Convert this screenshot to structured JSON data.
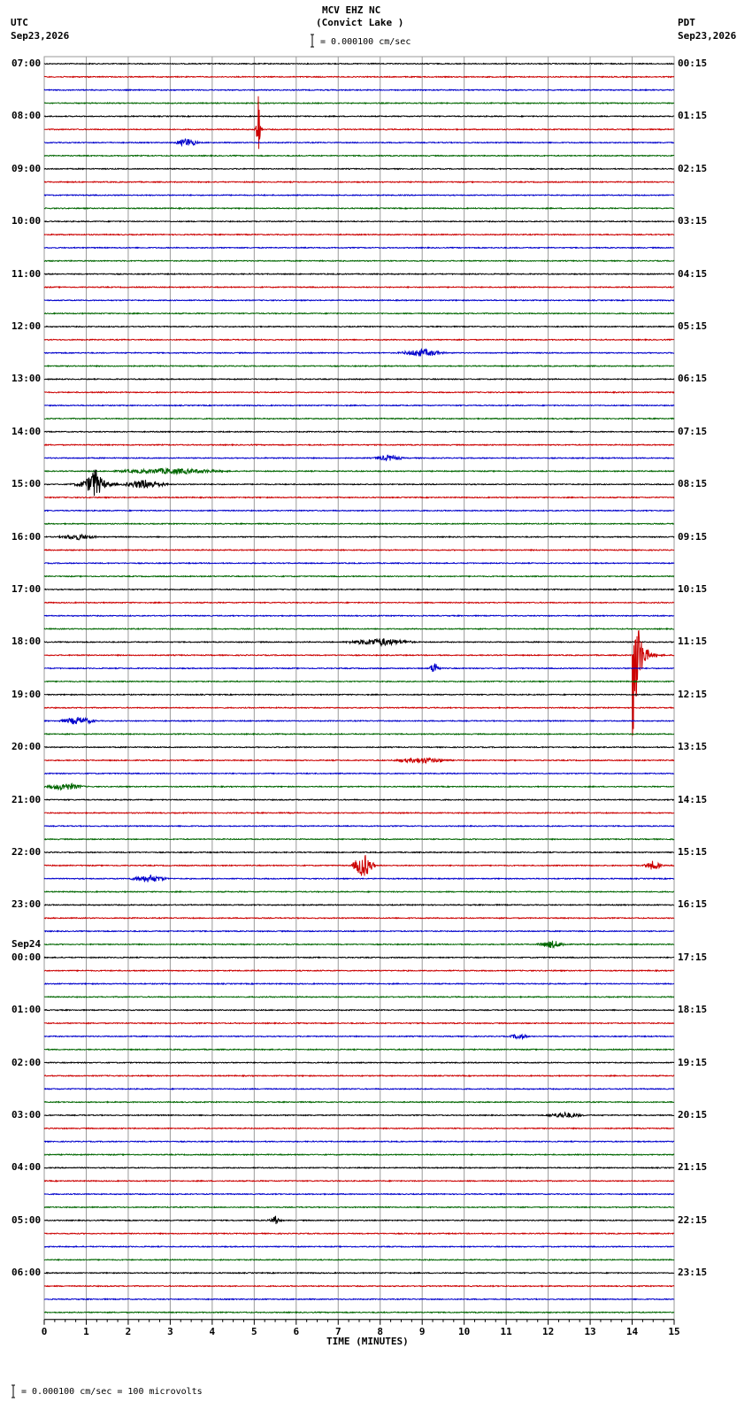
{
  "header": {
    "title": "MCV EHZ NC",
    "station": "(Convict Lake )",
    "scale": "= 0.000100 cm/sec",
    "left_tz": "UTC",
    "left_date": "Sep23,2026",
    "right_tz": "PDT",
    "right_date": "Sep23,2026"
  },
  "footer": {
    "scale_note": "= 0.000100 cm/sec =     100 microvolts"
  },
  "chart_data": {
    "type": "line",
    "title": "MCV EHZ NC (Convict Lake )",
    "xlabel": "TIME (MINUTES)",
    "xlim": [
      0,
      15
    ],
    "x_ticks": [
      "0",
      "1",
      "2",
      "3",
      "4",
      "5",
      "6",
      "7",
      "8",
      "9",
      "10",
      "11",
      "12",
      "13",
      "14",
      "15"
    ],
    "trace_colors": [
      "#000000",
      "#cc0000",
      "#0000cc",
      "#006600"
    ],
    "rows_per_hour": 4,
    "hours": 24,
    "left_labels": [
      "07:00",
      "08:00",
      "09:00",
      "10:00",
      "11:00",
      "12:00",
      "13:00",
      "14:00",
      "15:00",
      "16:00",
      "17:00",
      "18:00",
      "19:00",
      "20:00",
      "21:00",
      "22:00",
      "23:00",
      "00:00",
      "01:00",
      "02:00",
      "03:00",
      "04:00",
      "05:00",
      "06:00"
    ],
    "left_date_change": {
      "hour_index": 17,
      "label": "Sep24"
    },
    "right_labels": [
      "00:15",
      "01:15",
      "02:15",
      "03:15",
      "04:15",
      "05:15",
      "06:15",
      "07:15",
      "08:15",
      "09:15",
      "10:15",
      "11:15",
      "12:15",
      "13:15",
      "14:15",
      "15:15",
      "16:15",
      "17:15",
      "18:15",
      "19:15",
      "20:15",
      "21:15",
      "22:15",
      "23:15"
    ],
    "events": [
      {
        "row": 5,
        "minute": 5.1,
        "amplitude": 60,
        "duration": 0.1,
        "type": "spike"
      },
      {
        "row": 6,
        "minute": 3.4,
        "amplitude": 5,
        "duration": 0.6,
        "type": "burst"
      },
      {
        "row": 22,
        "minute": 9.0,
        "amplitude": 4,
        "duration": 1.2,
        "type": "burst"
      },
      {
        "row": 30,
        "minute": 8.2,
        "amplitude": 3,
        "duration": 0.8,
        "type": "burst"
      },
      {
        "row": 31,
        "minute": 3.0,
        "amplitude": 3,
        "duration": 3.0,
        "type": "burst"
      },
      {
        "row": 32,
        "minute": 1.2,
        "amplitude": 20,
        "duration": 0.6,
        "type": "spike"
      },
      {
        "row": 32,
        "minute": 2.4,
        "amplitude": 5,
        "duration": 1.2,
        "type": "burst"
      },
      {
        "row": 36,
        "minute": 0.8,
        "amplitude": 3,
        "duration": 1.0,
        "type": "burst"
      },
      {
        "row": 44,
        "minute": 8.0,
        "amplitude": 4,
        "duration": 1.8,
        "type": "burst"
      },
      {
        "row": 45,
        "minute": 14.0,
        "amplitude": 120,
        "duration": 1.0,
        "type": "quake"
      },
      {
        "row": 46,
        "minute": 9.3,
        "amplitude": 7,
        "duration": 0.3,
        "type": "burst"
      },
      {
        "row": 50,
        "minute": 0.8,
        "amplitude": 4,
        "duration": 1.0,
        "type": "burst"
      },
      {
        "row": 53,
        "minute": 9.0,
        "amplitude": 3,
        "duration": 1.5,
        "type": "burst"
      },
      {
        "row": 55,
        "minute": 0.5,
        "amplitude": 4,
        "duration": 1.0,
        "type": "burst"
      },
      {
        "row": 61,
        "minute": 7.6,
        "amplitude": 14,
        "duration": 0.6,
        "type": "burst"
      },
      {
        "row": 61,
        "minute": 14.5,
        "amplitude": 5,
        "duration": 0.5,
        "type": "burst"
      },
      {
        "row": 62,
        "minute": 2.5,
        "amplitude": 4,
        "duration": 1.0,
        "type": "burst"
      },
      {
        "row": 67,
        "minute": 12.1,
        "amplitude": 4,
        "duration": 0.8,
        "type": "burst"
      },
      {
        "row": 74,
        "minute": 11.3,
        "amplitude": 3,
        "duration": 0.5,
        "type": "burst"
      },
      {
        "row": 80,
        "minute": 12.4,
        "amplitude": 3,
        "duration": 1.0,
        "type": "burst"
      },
      {
        "row": 88,
        "minute": 5.5,
        "amplitude": 8,
        "duration": 0.2,
        "type": "spike"
      }
    ]
  }
}
